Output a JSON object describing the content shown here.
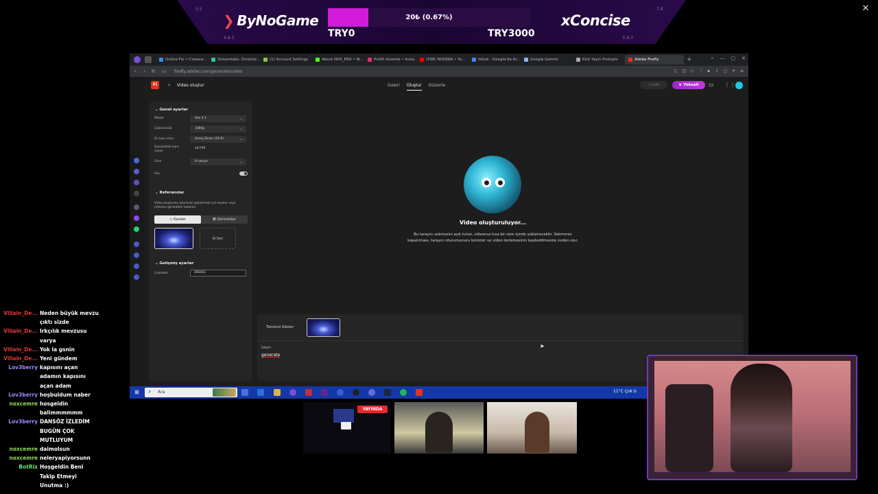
{
  "banner": {
    "left_brand": "ByNoGame",
    "right_brand": "xConcise",
    "progress_text": "20₺ (0.67%)",
    "progress_fraction": 0.2,
    "left_amount": "TRY0",
    "right_amount": "TRY3000",
    "score_tl": "5.5",
    "score_bl": "4.8.3",
    "score_tr": "7.8",
    "score_br": "E.8.7",
    "close": "✕"
  },
  "browser": {
    "tabs": [
      {
        "label": "Online-Fix • Страни...",
        "color": "#3a8ee6"
      },
      {
        "label": "Streamlabs: Ücretsiz...",
        "color": "#31c3a2"
      },
      {
        "label": "(1) Account Settings",
        "color": "#8bc34a"
      },
      {
        "label": "About NOX_ERA • W...",
        "color": "#53fc18"
      },
      {
        "label": "Profili düzenle • Insta...",
        "color": "#e1306c"
      },
      {
        "label": "(598) NOXERA • Yo...",
        "color": "#ff0000"
      },
      {
        "label": "tiktok - Google'da Ar...",
        "color": "#4285f4"
      },
      {
        "label": "Google Gemini",
        "color": "#8ab4f8"
      },
      {
        "label": "Kick Yayın Prompts",
        "color": "#aaaaaa"
      },
      {
        "label": "Adobe Firefly",
        "color": "#e3341b",
        "active": true
      }
    ],
    "url": "firefly.adobe.com/generate/video"
  },
  "app": {
    "logo": "Fi",
    "page_title": "Video oluştur",
    "nav": [
      "Galeri",
      "Oluştur",
      "Düzenle"
    ],
    "nav_active": "Oluştur",
    "download_label": "İndir",
    "upgrade_label": "Yükselt",
    "general_settings": "Genel ayarlar",
    "fields": [
      {
        "label": "Model",
        "value": "Veo 3.1"
      },
      {
        "label": "Çözünürlük",
        "value": "1080p"
      },
      {
        "label": "En boy oranı",
        "value": "Geniş Ekran (16:9)"
      },
      {
        "label": "Saniyedeki kare sayısı",
        "value": "24 FPS"
      },
      {
        "label": "Süre",
        "value": "8 saniye"
      }
    ],
    "sound_label": "Ses",
    "sound_on": true,
    "references_title": "Referanslar",
    "references_desc": "Video oluşturma işleminizi geliştirmek için kareler veya referans görüntüler kullanın.",
    "seg_frames": "Kareler",
    "seg_images": "Görüntüler",
    "end_frame_label": "Son",
    "advanced_title": "Gelişmiş ayarlar",
    "seed_label": "Çekirdek",
    "seed_value": "292411",
    "generating_title": "Video oluşturuluyor...",
    "generating_desc": "Bu tarayıcı sekmesini açık tutun, videonuz kısa bir süre içinde yüklenecektir. Sekmenin kapatılması, tarayıcı oturumunuzu temizler ve video ilerlemesinin kaybedilmesine neden olur.",
    "show_all": "Tümünü Göster",
    "prompt_label": "İstem",
    "prompt_text": "generate"
  },
  "taskbar": {
    "search_placeholder": "Ara",
    "weather": "11°C  Çok b"
  },
  "chat": [
    {
      "user": "Villain_De...",
      "color": "#e23a3a",
      "msg": "Neden büyük mevzu"
    },
    {
      "user": "",
      "color": "#e23a3a",
      "msg": "çıktı sizde"
    },
    {
      "user": "Villain_De...",
      "color": "#e23a3a",
      "msg": "Irkçılık mevzusu"
    },
    {
      "user": "",
      "color": "#e23a3a",
      "msg": "varya"
    },
    {
      "user": "Villain_De...",
      "color": "#e23a3a",
      "msg": "Yok la gsnin"
    },
    {
      "user": "Villain_De...",
      "color": "#e23a3a",
      "msg": "Yeni gündem"
    },
    {
      "user": "Lov3berry",
      "color": "#9b8cff",
      "msg": "kapısını açan"
    },
    {
      "user": "",
      "color": "#9b8cff",
      "msg": "adamın kapısını"
    },
    {
      "user": "",
      "color": "#9b8cff",
      "msg": "açan adam"
    },
    {
      "user": "Lov3berry",
      "color": "#9b8cff",
      "msg": "hoşbuldum naber"
    },
    {
      "user": "noxcemre",
      "color": "#8fdc5a",
      "msg": "hosgeldin"
    },
    {
      "user": "",
      "color": "#8fdc5a",
      "msg": "balimmmmmm"
    },
    {
      "user": "Lov3berry",
      "color": "#9b8cff",
      "msg": "DANSÖZ İZLEDİM"
    },
    {
      "user": "",
      "color": "#9b8cff",
      "msg": "BUGÜN ÇOK"
    },
    {
      "user": "",
      "color": "#9b8cff",
      "msg": "MUTLUYUM"
    },
    {
      "user": "noxcemre",
      "color": "#8fdc5a",
      "msg": "daimolsun"
    },
    {
      "user": "noxcemre",
      "color": "#8fdc5a",
      "msg": "neleryapiyorsunn"
    },
    {
      "user": "BotRix",
      "color": "#6ee36e",
      "msg": "Hoşgeldin Beni"
    },
    {
      "user": "",
      "color": "#6ee36e",
      "msg": "Takip Etmeyi"
    },
    {
      "user": "",
      "color": "#6ee36e",
      "msg": "Unutma :)"
    }
  ],
  "live_badge": "YAYINDA"
}
